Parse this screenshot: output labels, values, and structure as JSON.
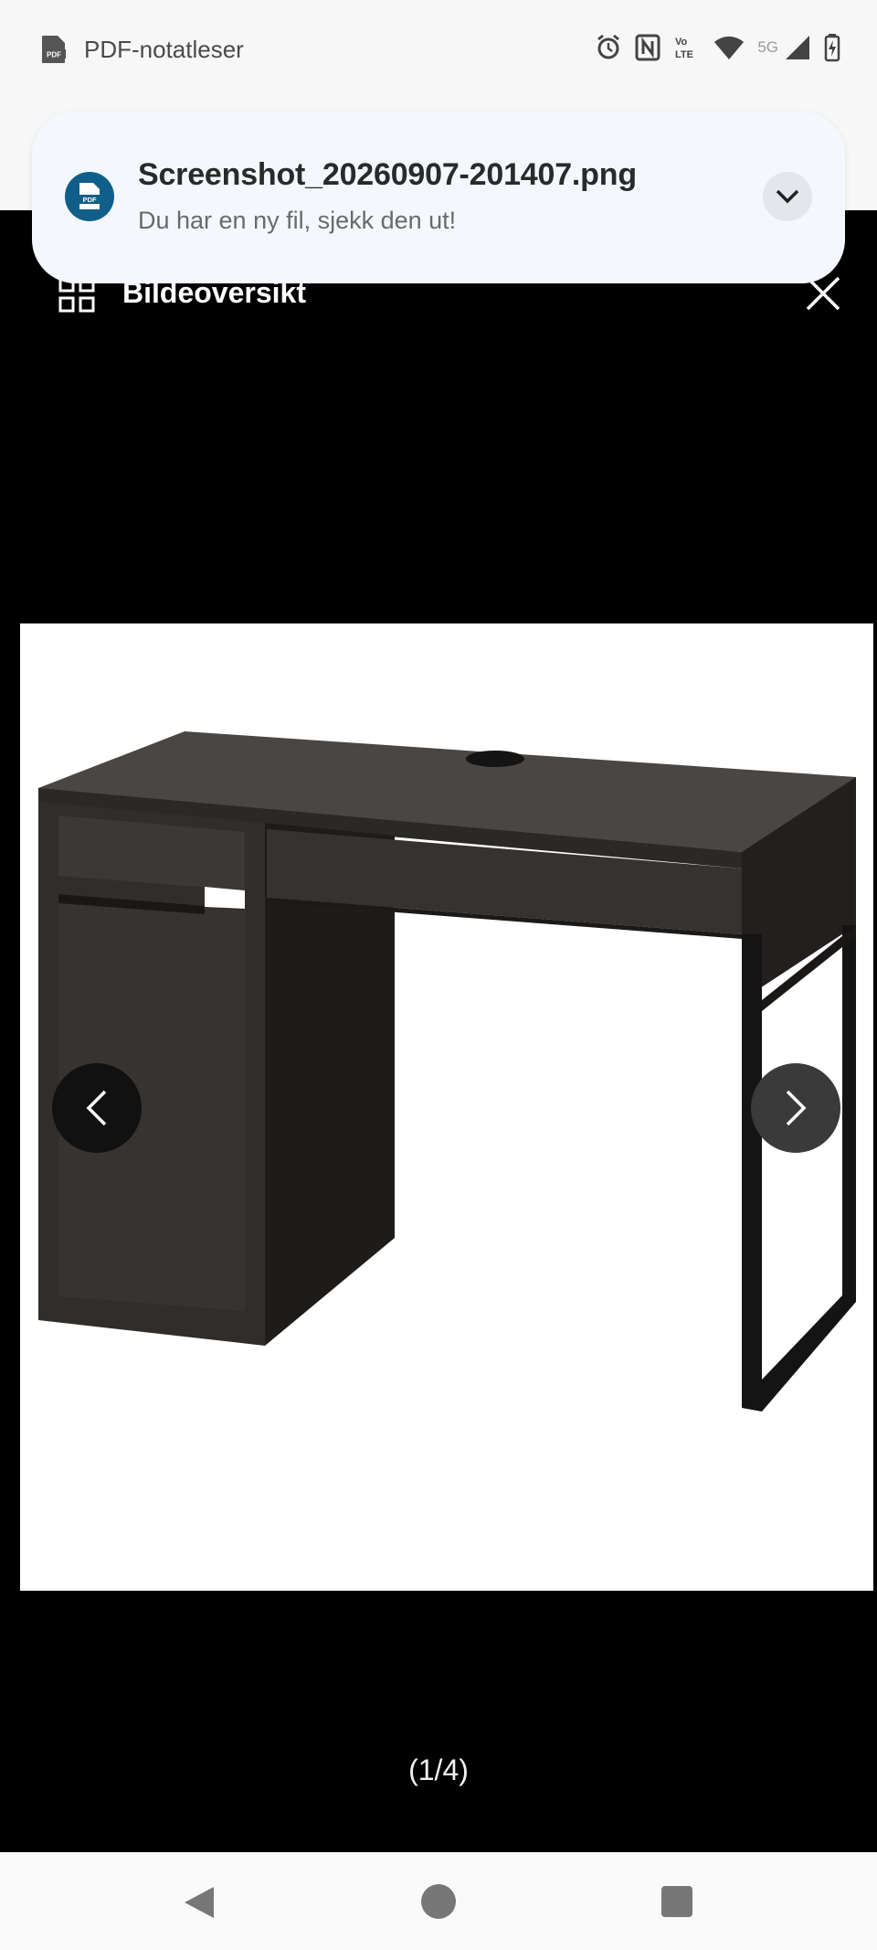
{
  "status_bar": {
    "app_name": "PDF-notatleser",
    "app_icon": "pdf-file-icon",
    "network_label": "5G",
    "icons": [
      "alarm-icon",
      "nfc-icon",
      "volte-icon",
      "wifi-icon",
      "cell-signal-icon",
      "battery-charging-icon"
    ]
  },
  "notification": {
    "title": "Screenshot_20260907-201407.png",
    "subtitle": "Du har en ny fil, sjekk den ut!",
    "icon": "pdf-badge-icon",
    "expand_icon": "chevron-down-icon",
    "accent": "#0f5f8a"
  },
  "viewer": {
    "title": "Bildeoversikt",
    "grid_icon": "grid-icon",
    "close_icon": "close-icon",
    "counter": "(1/4)",
    "current_index": 1,
    "total": 4,
    "image_subject": "desk-photo"
  },
  "nav_bar": {
    "back": "back-triangle-icon",
    "home": "home-circle-icon",
    "recents": "recents-square-icon"
  }
}
